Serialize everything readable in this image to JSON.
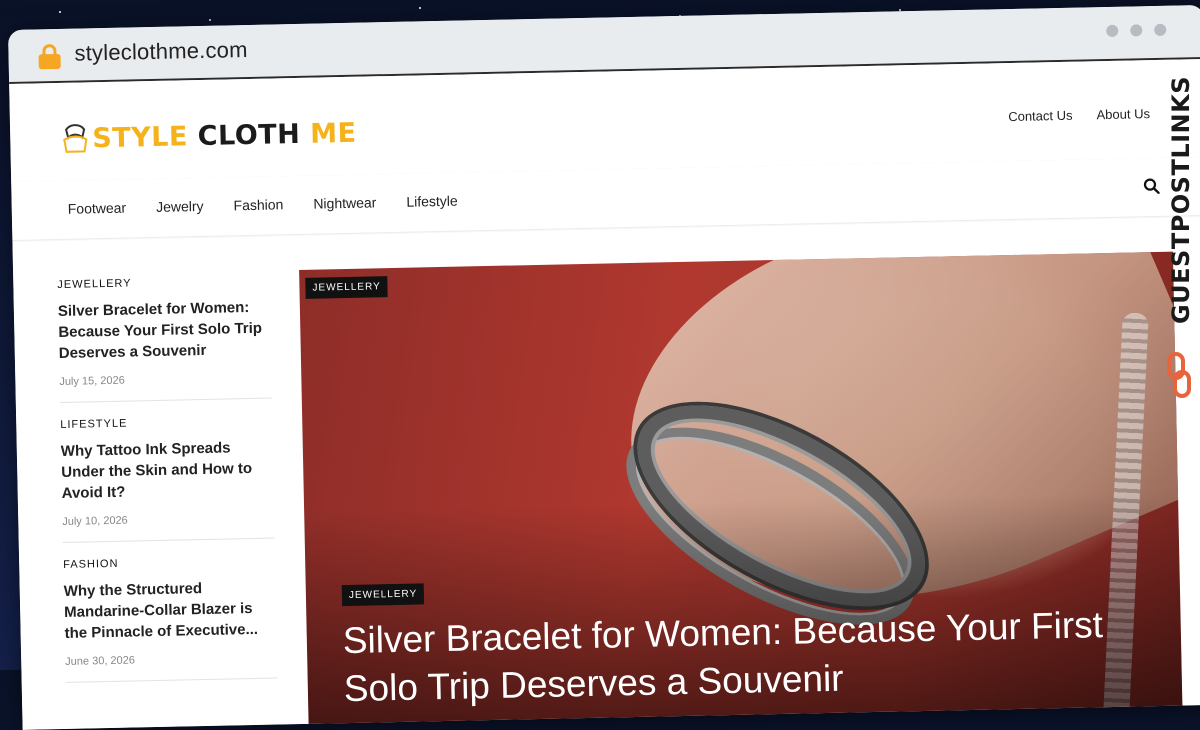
{
  "browser": {
    "url": "styleclothme.com"
  },
  "site": {
    "logo": {
      "style": "STYLE",
      "cloth": "CLOTH",
      "me": "ME"
    },
    "top_links": [
      "Contact Us",
      "About Us"
    ],
    "nav": [
      "Footwear",
      "Jewelry",
      "Fashion",
      "Nightwear",
      "Lifestyle"
    ]
  },
  "sidebar": {
    "posts": [
      {
        "category": "JEWELLERY",
        "title": "Silver Bracelet for Women: Because Your First Solo Trip Deserves a Souvenir",
        "date": "July 15, 2026"
      },
      {
        "category": "LIFESTYLE",
        "title": "Why Tattoo Ink Spreads Under the Skin and How to Avoid It?",
        "date": "July 10, 2026"
      },
      {
        "category": "FASHION",
        "title": "Why the Structured Mandarine-Collar Blazer is the Pinnacle of Executive...",
        "date": "June 30, 2026"
      }
    ]
  },
  "hero": {
    "badge_top": "JEWELLERY",
    "badge_bottom": "JEWELLERY",
    "title": "Silver Bracelet for Women: Because Your First Solo Trip Deserves a Souvenir"
  },
  "side_banner": {
    "text": "GUESTPOSTLINKS"
  },
  "colors": {
    "accent": "#f5b21b",
    "banner_icon": "#e8643c"
  }
}
